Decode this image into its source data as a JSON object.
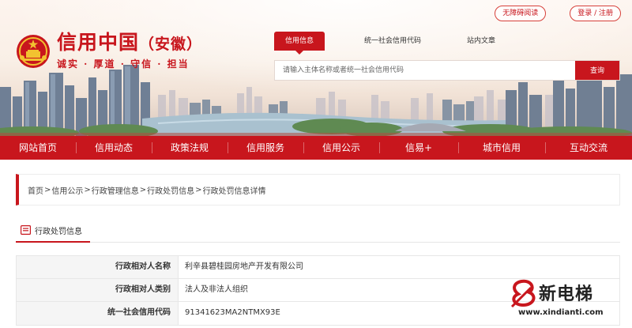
{
  "header": {
    "site_title": "信用中国",
    "site_region": "（安徽）",
    "slogan": "诚实 · 厚道 · 守信 · 担当",
    "top_links": [
      "无障碍阅读",
      "登录 / 注册"
    ]
  },
  "search": {
    "tabs": [
      "信用信息",
      "统一社会信用代码",
      "站内文章"
    ],
    "active_tab": "信用信息",
    "placeholder": "请输入主体名称或者统一社会信用代码",
    "button": "查询"
  },
  "nav": {
    "items": [
      "网站首页",
      "信用动态",
      "政策法规",
      "信用服务",
      "信用公示",
      "信易+",
      "城市信用",
      "互动交流"
    ]
  },
  "breadcrumb": {
    "items": [
      "首页",
      "信用公示",
      "行政管理信息",
      "行政处罚信息",
      "行政处罚信息详情"
    ],
    "separator": ">"
  },
  "section": {
    "tab_label": "行政处罚信息"
  },
  "detail": {
    "rows": [
      {
        "label": "行政相对人名称",
        "value": "利辛县碧桂园房地产开发有限公司"
      },
      {
        "label": "行政相对人类别",
        "value": "法人及非法人组织"
      },
      {
        "label": "统一社会信用代码",
        "value": "91341623MA2NTMX93E"
      }
    ]
  },
  "watermark": {
    "text": "新电梯",
    "url": "www.xindianti.com"
  },
  "colors": {
    "brand_red": "#c8161d",
    "label_bg": "#f5f5f5"
  }
}
